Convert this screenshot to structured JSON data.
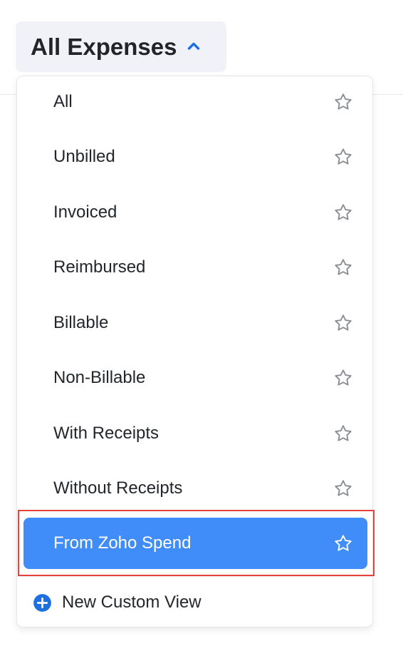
{
  "header": {
    "title": "All Expenses"
  },
  "dropdown": {
    "items": [
      {
        "label": "All"
      },
      {
        "label": "Unbilled"
      },
      {
        "label": "Invoiced"
      },
      {
        "label": "Reimbursed"
      },
      {
        "label": "Billable"
      },
      {
        "label": "Non-Billable"
      },
      {
        "label": "With Receipts"
      },
      {
        "label": "Without Receipts"
      },
      {
        "label": "From Zoho Spend"
      }
    ],
    "selected_label": "From Zoho Spend",
    "new_custom_view_label": "New Custom View"
  },
  "icons": {
    "toggle_indicator": "chevron-up-icon",
    "favorite": "star-outline-icon",
    "add_view": "plus-circle-icon"
  },
  "colors": {
    "accent": "#408dfa",
    "chevron": "#1e6fe0",
    "selection_outline": "#e8413d"
  }
}
